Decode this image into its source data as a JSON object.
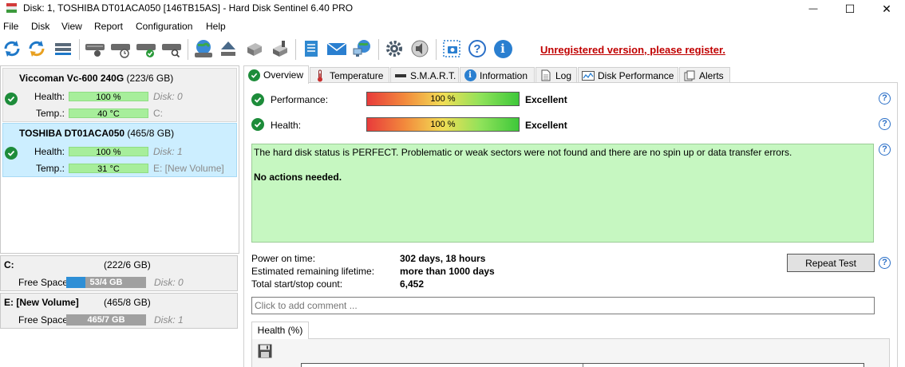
{
  "window": {
    "title": "Disk: 1, TOSHIBA DT01ACA050 [146TB15AS]  -  Hard Disk Sentinel 6.40 PRO",
    "minimize_glyph": "—",
    "maximize_glyph": "☐",
    "close_glyph": "✕"
  },
  "menu": {
    "items": [
      "File",
      "Disk",
      "View",
      "Report",
      "Configuration",
      "Help"
    ]
  },
  "toolbar": {
    "icons": [
      "refresh-icon",
      "refresh-all-icon",
      "disk-list-icon",
      "disk-icon",
      "disk-schedule-icon",
      "disk-check-icon",
      "disk-search-icon",
      "globe-disk-icon",
      "eject-icon",
      "disk-tools-icon",
      "disk-test-icon",
      "report-icon",
      "mail-icon",
      "network-icon",
      "settings-icon",
      "sound-icon",
      "screenshot-icon",
      "help-icon",
      "info-icon"
    ],
    "register_text": "Unregistered version, please register.",
    "help_glyph": "?",
    "info_glyph": "i"
  },
  "disks": [
    {
      "model": "Viccoman Vc-600 240G",
      "size": "(223/6 GB)",
      "health_label": "Health:",
      "health": "100 %",
      "health_level": 100,
      "temp_label": "Temp.:",
      "temp": "40 °C",
      "disk_index": "Disk: 0",
      "volumes": "C:"
    },
    {
      "model": "TOSHIBA DT01ACA050",
      "size": "(465/8 GB)",
      "health_label": "Health:",
      "health": "100 %",
      "health_level": 100,
      "temp_label": "Temp.:",
      "temp": "31 °C",
      "disk_index": "Disk: 1",
      "volumes": "E: [New Volume]"
    }
  ],
  "volumes": [
    {
      "name": "C:",
      "size": "(222/6 GB)",
      "free_label": "Free Space",
      "free": "53/4 GB",
      "free_fraction": 0.24,
      "disk_index": "Disk: 0",
      "fill_color": "#2e8fd6"
    },
    {
      "name": "E: [New Volume]",
      "size": "(465/8 GB)",
      "free_label": "Free Space",
      "free": "465/7 GB",
      "free_fraction": 1.0,
      "disk_index": "Disk: 1",
      "fill_color": "#a0a0a0"
    }
  ],
  "tabs": [
    {
      "label": "Overview",
      "icon": "check-icon"
    },
    {
      "label": "Temperature",
      "icon": "thermometer-icon"
    },
    {
      "label": "S.M.A.R.T.",
      "icon": "smart-icon"
    },
    {
      "label": "Information",
      "icon": "info-icon"
    },
    {
      "label": "Log",
      "icon": "log-icon"
    },
    {
      "label": "Disk Performance",
      "icon": "performance-icon"
    },
    {
      "label": "Alerts",
      "icon": "alerts-icon"
    }
  ],
  "overview": {
    "performance_label": "Performance:",
    "performance_value": "100 %",
    "performance_level": 100,
    "performance_rating": "Excellent",
    "health_label": "Health:",
    "health_value": "100 %",
    "health_level": 100,
    "health_rating": "Excellent",
    "status_text": "The hard disk status is PERFECT. Problematic or weak sectors were not found and there are no spin up or data transfer errors.",
    "action_text": "No actions needed.",
    "power_on_label": "Power on time:",
    "power_on_value": "302 days, 18 hours",
    "lifetime_label": "Estimated remaining lifetime:",
    "lifetime_value": "more than 1000 days",
    "startstop_label": "Total start/stop count:",
    "startstop_value": "6,452",
    "repeat_test_label": "Repeat Test",
    "comment_placeholder": "Click to add comment ...",
    "subtab_label": "Health (%)",
    "help_glyph": "?"
  },
  "colors": {
    "status_green": "#c6f7c1",
    "check_green": "#1d8c3a",
    "register_red": "#c00000",
    "selected_disk": "#cceeff"
  }
}
